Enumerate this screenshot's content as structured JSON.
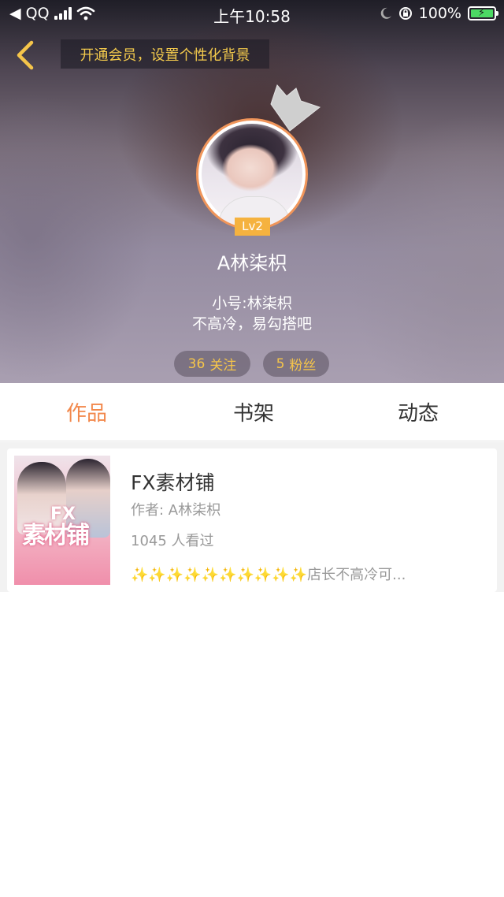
{
  "status_bar": {
    "back_app": "QQ",
    "time": "上午10:58",
    "battery": "100%"
  },
  "header": {
    "vip_banner": "开通会员，设置个性化背景",
    "level": "Lv2",
    "username": "A林柒枳",
    "bio_line1": "小号:林柒枳",
    "bio_line2": "不高冷，易勾搭吧",
    "following_count": "36",
    "following_label": "关注",
    "fans_count": "5",
    "fans_label": "粉丝"
  },
  "tabs": [
    {
      "label": "作品",
      "active": true
    },
    {
      "label": "书架",
      "active": false
    },
    {
      "label": "动态",
      "active": false
    }
  ],
  "works": [
    {
      "title": "FX素材铺",
      "author": "作者: A林柒枳",
      "views": "1045 人看过",
      "description": "✨✨✨✨✨✨✨✨✨✨店长不高冷可...",
      "cover_text": "素材铺",
      "cover_fx": "FX"
    }
  ],
  "colors": {
    "accent": "#f2884b",
    "gold": "#f5c54a",
    "badge": "#f5b23f",
    "battery_green": "#4cd964"
  }
}
